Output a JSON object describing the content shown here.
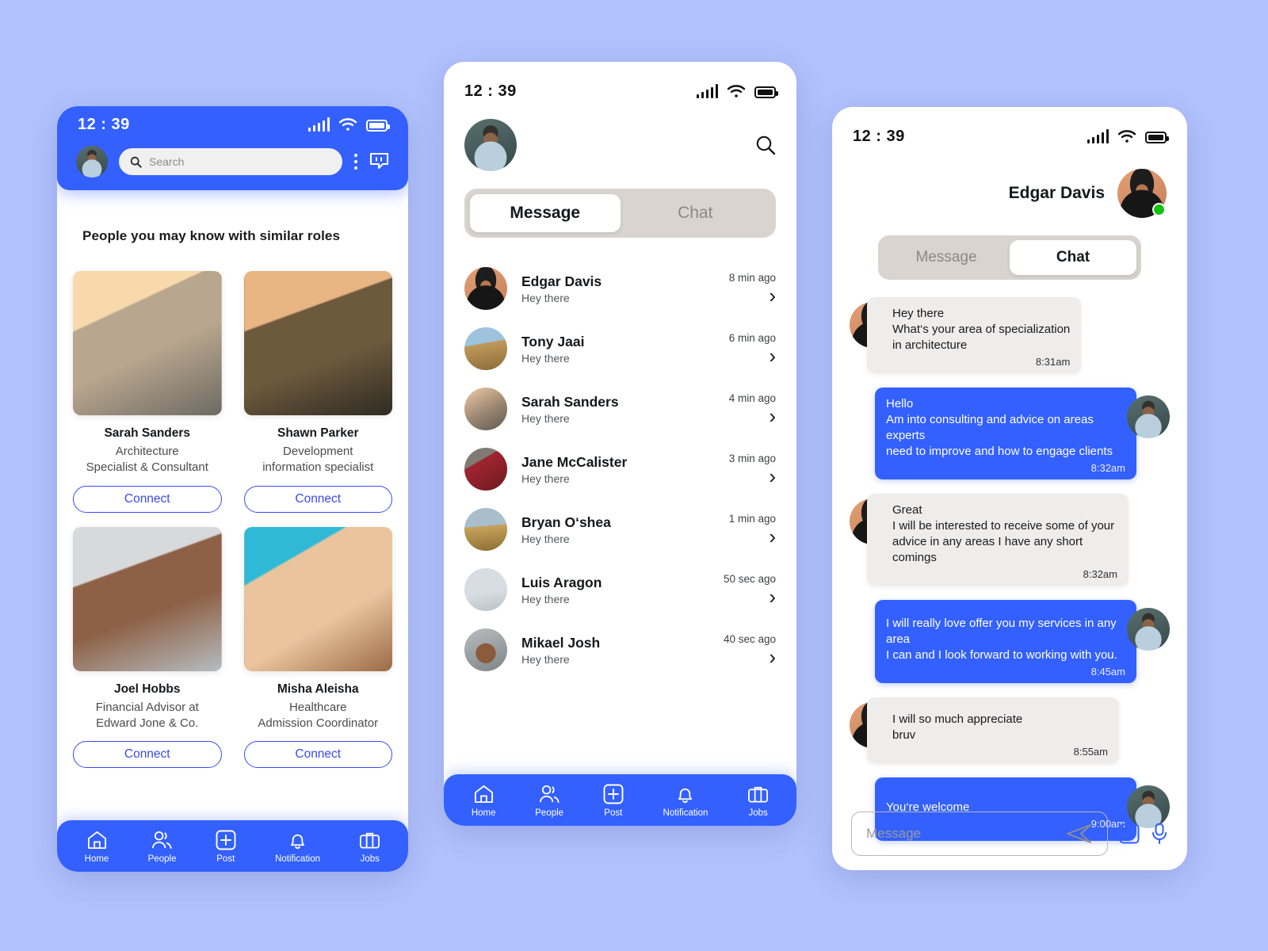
{
  "theme": {
    "accent": "#3360ff",
    "connect_border": "#3a49ef",
    "page_background": "#b2c2fd",
    "online_dot": "#12c312"
  },
  "phone1": {
    "status": {
      "time": "12 : 39"
    },
    "search": {
      "placeholder": "Search",
      "value": ""
    },
    "icons": {
      "search": "search-icon",
      "menu": "more-vertical-icon",
      "chat": "chat-bubble-icon",
      "avatar": "user-avatar"
    },
    "section_title": "People you may know with similar roles",
    "people": [
      {
        "name": "Sarah Sanders",
        "role_line1": "Architecture",
        "role_line2": "Specialist & Consultant",
        "action": "Connect"
      },
      {
        "name": "Shawn Parker",
        "role_line1": "Development",
        "role_line2": "information specialist",
        "action": "Connect"
      },
      {
        "name": "Joel Hobbs",
        "role_line1": "Financial Advisor at",
        "role_line2": "Edward Jone & Co.",
        "action": "Connect"
      },
      {
        "name": "Misha Aleisha",
        "role_line1": "Healthcare",
        "role_line2": "Admission Coordinator",
        "action": "Connect"
      }
    ],
    "nav": [
      {
        "label": "Home",
        "icon": "home-icon"
      },
      {
        "label": "People",
        "icon": "people-icon"
      },
      {
        "label": "Post",
        "icon": "plus-square-icon"
      },
      {
        "label": "Notification",
        "icon": "bell-icon"
      },
      {
        "label": "Jobs",
        "icon": "briefcase-icon"
      }
    ]
  },
  "phone2": {
    "status": {
      "time": "12 : 39"
    },
    "icons": {
      "search": "search-icon",
      "avatar": "user-avatar"
    },
    "tabs": [
      {
        "label": "Message",
        "active": true
      },
      {
        "label": "Chat",
        "active": false
      }
    ],
    "conversations": [
      {
        "name": "Edgar Davis",
        "preview": "Hey there",
        "time": "8 min ago"
      },
      {
        "name": "Tony Jaai",
        "preview": "Hey there",
        "time": "6 min ago"
      },
      {
        "name": "Sarah Sanders",
        "preview": "Hey there",
        "time": "4 min ago"
      },
      {
        "name": "Jane McCalister",
        "preview": "Hey there",
        "time": "3 min ago"
      },
      {
        "name": "Bryan O‘shea",
        "preview": "Hey there",
        "time": "1 min ago"
      },
      {
        "name": "Luis Aragon",
        "preview": "Hey there",
        "time": "50 sec ago"
      },
      {
        "name": "Mikael Josh",
        "preview": "Hey there",
        "time": "40 sec ago"
      }
    ],
    "nav": [
      {
        "label": "Home",
        "icon": "home-icon"
      },
      {
        "label": "People",
        "icon": "people-icon"
      },
      {
        "label": "Post",
        "icon": "plus-square-icon"
      },
      {
        "label": "Notification",
        "icon": "bell-icon"
      },
      {
        "label": "Jobs",
        "icon": "briefcase-icon"
      }
    ]
  },
  "phone3": {
    "status": {
      "time": "12 : 39"
    },
    "contact": {
      "name": "Edgar Davis",
      "presence": "online"
    },
    "tabs": [
      {
        "label": "Message",
        "active": false
      },
      {
        "label": "Chat",
        "active": true
      }
    ],
    "messages": [
      {
        "side": "in",
        "text": "Hey there\nWhat‘s your area of specialization\nin architecture",
        "time": "8:31am"
      },
      {
        "side": "out",
        "text": "Hello\nAm into consulting and advice on areas experts\nneed to improve and how to engage clients",
        "time": "8:32am"
      },
      {
        "side": "in",
        "text": "Great\nI will be interested to receive some of your\nadvice in any areas I have any short comings",
        "time": "8:32am"
      },
      {
        "side": "out",
        "text": "I will really love offer you my services in any area\nI can and I look forward to working with you.",
        "time": "8:45am"
      },
      {
        "side": "in",
        "text": "I will so much appreciate\nbruv",
        "time": "8:55am"
      },
      {
        "side": "out",
        "text": "You‘re welcome",
        "time": "9:00am"
      }
    ],
    "composer": {
      "placeholder": "Message",
      "value": "",
      "send_icon": "send-icon",
      "attach_icon": "plus-square-icon",
      "mic_icon": "microphone-icon"
    }
  }
}
